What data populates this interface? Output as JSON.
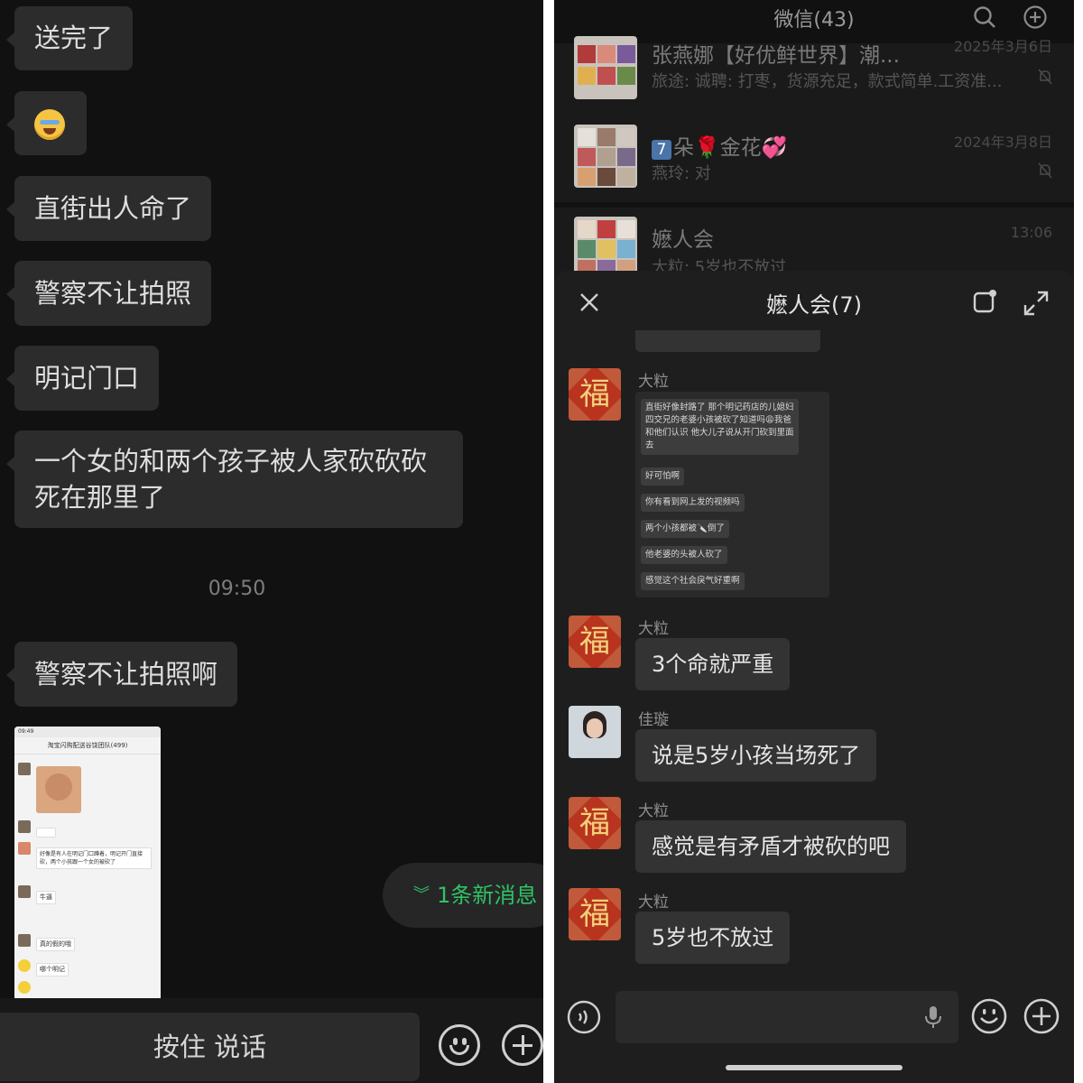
{
  "left_chat": {
    "messages": [
      {
        "text": "送完了"
      },
      {
        "text": "",
        "emoji": "crying-laughing-emoji"
      },
      {
        "text": "直街出人命了"
      },
      {
        "text": "警察不让拍照"
      },
      {
        "text": "明记门口"
      },
      {
        "text_line1": "一个女的和两个孩子被人家砍砍砍",
        "text_line2": "死在那里了"
      },
      {
        "text": "警察不让拍照啊"
      }
    ],
    "time_divider": "09:50",
    "thumbnail": {
      "status_time": "09:49",
      "title": "淘宝闪购配送谷饶团队(499)",
      "line1": "好像是有人在明记门口蹲着，明记开门直接砍，两个小孩跟一个女的被砍了",
      "line2": "牛逼",
      "line3": "真的假的哦",
      "line4": "哪个明记"
    },
    "new_messages": "1条新消息",
    "hold_to_talk": "按住 说话"
  },
  "right_panel": {
    "app_title": "微信(43)",
    "chat_list": [
      {
        "name": "张燕娜【好优鲜世界】潮...",
        "snippet": "旅途: 诚聘: 打枣，货源充足，款式简单.工资准...",
        "time": "2025年3月6日"
      },
      {
        "badge": "7",
        "name": "朵🌹金花💞",
        "snippet": "燕玲: 对",
        "time": "2024年3月8日"
      },
      {
        "name": "嬷人会",
        "snippet": "大粒: 5岁也不放过",
        "time": "13:06"
      }
    ],
    "modal": {
      "title": "嬷人会(7)",
      "messages": [
        {
          "sender": "大粒",
          "type": "forward"
        },
        {
          "sender": "大粒",
          "text": "3个命就严重"
        },
        {
          "sender": "佳璇",
          "text": "说是5岁小孩当场死了"
        },
        {
          "sender": "大粒",
          "text": "感觉是有矛盾才被砍的吧"
        },
        {
          "sender": "大粒",
          "text": "5岁也不放过"
        }
      ],
      "forwarded": [
        "直街好像封路了 那个明记药店的儿媳妇 四交兄的老婆小孩被砍了知道吗😩我爸和他们认识 他大儿子说从开门砍到里面去",
        "好可怕啊",
        "你有看到网上发的视频吗",
        "两个小孩都被🔪倒了",
        "他老婆的头被人砍了",
        "感觉这个社会戾气好重啊"
      ]
    }
  },
  "colors": {
    "accent_green": "#2fc266",
    "bubble": "#2c2c2c",
    "background": "#111111"
  }
}
